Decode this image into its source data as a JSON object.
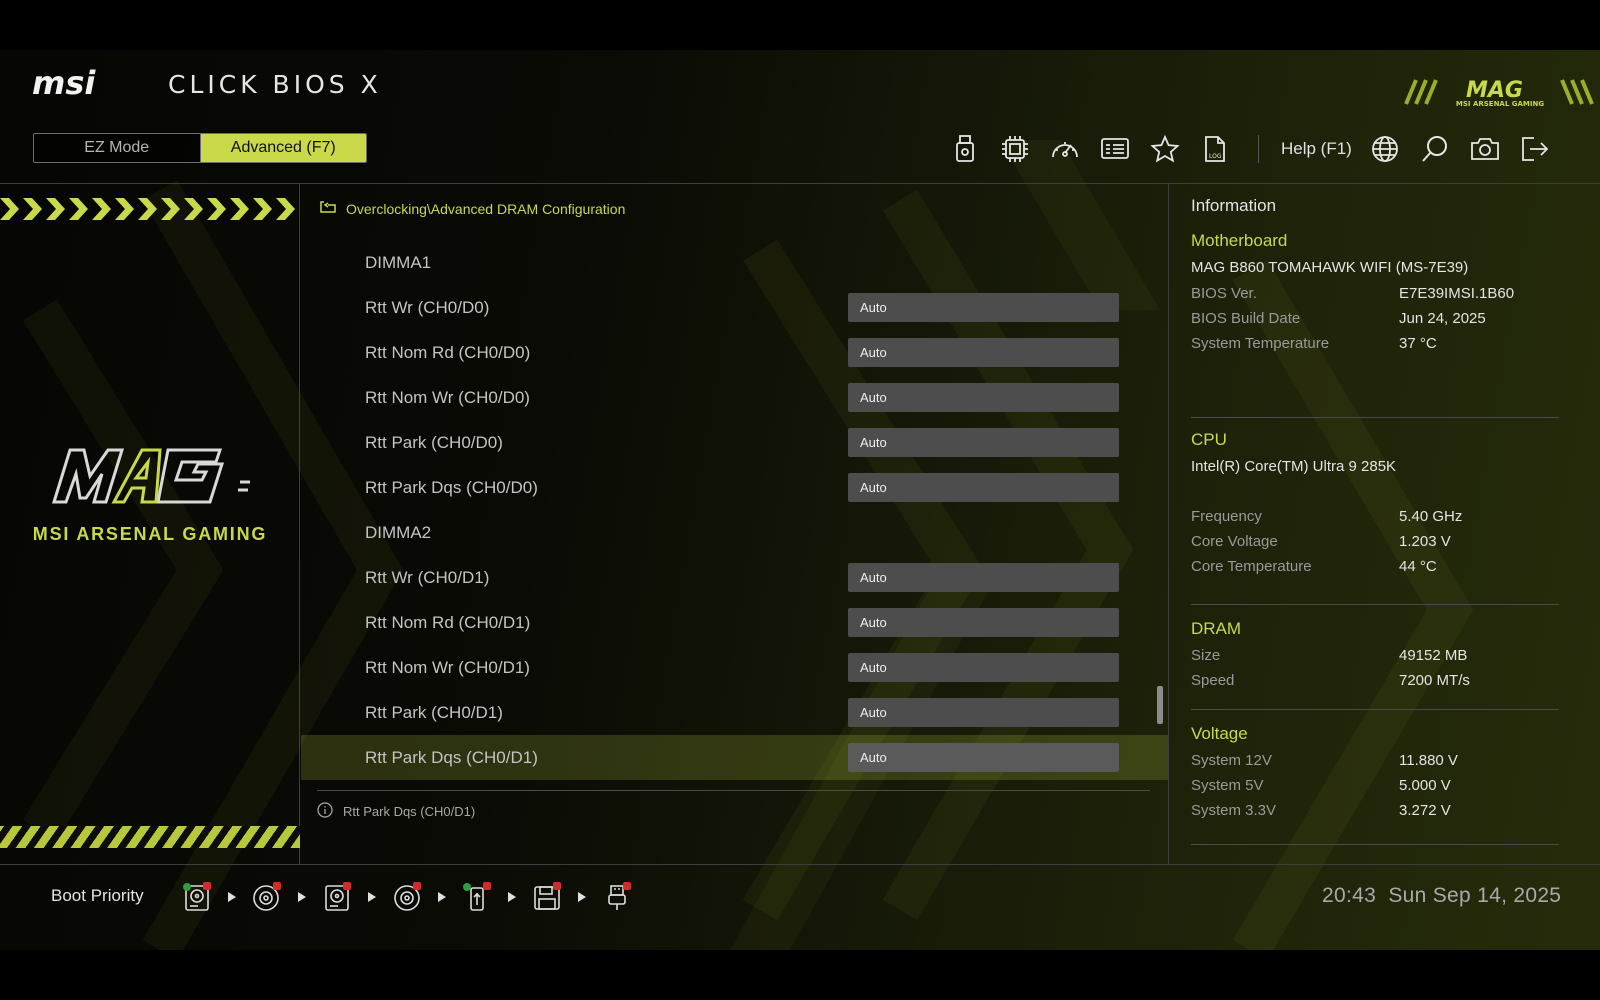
{
  "header": {
    "brand": "msi",
    "product_title": "CLICK BIOS X",
    "mag_logo_text": "MAG",
    "mag_logo_sub": "MSI ARSENAL GAMING",
    "modes": {
      "ez": "EZ Mode",
      "advanced": "Advanced (F7)"
    },
    "toolbar": {
      "icons": [
        "usb-flash-icon",
        "cpu-icon",
        "speedometer-icon",
        "memory-info-icon",
        "favorite-star-icon",
        "log-file-icon",
        "language-globe-icon",
        "search-icon",
        "screenshot-camera-icon",
        "exit-icon"
      ],
      "help_label": "Help (F1)"
    }
  },
  "left_panel": {
    "logo_text": "MAG",
    "logo_caption": "MSI ARSENAL GAMING"
  },
  "breadcrumb": "Overclocking\\Advanced DRAM Configuration",
  "settings": {
    "groups": [
      {
        "label": "DIMMA1",
        "items": [
          {
            "label": "Rtt Wr (CH0/D0)",
            "value": "Auto"
          },
          {
            "label": "Rtt Nom Rd (CH0/D0)",
            "value": "Auto"
          },
          {
            "label": "Rtt Nom Wr (CH0/D0)",
            "value": "Auto"
          },
          {
            "label": "Rtt Park (CH0/D0)",
            "value": "Auto"
          },
          {
            "label": "Rtt Park Dqs (CH0/D0)",
            "value": "Auto"
          }
        ]
      },
      {
        "label": "DIMMA2",
        "items": [
          {
            "label": "Rtt Wr (CH0/D1)",
            "value": "Auto"
          },
          {
            "label": "Rtt Nom Rd (CH0/D1)",
            "value": "Auto"
          },
          {
            "label": "Rtt Nom Wr (CH0/D1)",
            "value": "Auto"
          },
          {
            "label": "Rtt Park (CH0/D1)",
            "value": "Auto"
          },
          {
            "label": "Rtt Park Dqs (CH0/D1)",
            "value": "Auto"
          }
        ]
      }
    ],
    "selected": "Rtt Park Dqs (CH0/D1)",
    "help_text": "Rtt Park Dqs (CH0/D1)"
  },
  "info": {
    "title": "Information",
    "motherboard": {
      "title": "Motherboard",
      "model": "MAG B860 TOMAHAWK WIFI (MS-7E39)",
      "rows": [
        {
          "k": "BIOS Ver.",
          "v": "E7E39IMSI.1B60"
        },
        {
          "k": "BIOS Build Date",
          "v": "Jun 24, 2025"
        },
        {
          "k": "System Temperature",
          "v": "37 °C"
        }
      ]
    },
    "cpu": {
      "title": "CPU",
      "model": "Intel(R) Core(TM) Ultra 9 285K",
      "rows": [
        {
          "k": "Frequency",
          "v": "5.40 GHz"
        },
        {
          "k": "Core Voltage",
          "v": "1.203 V"
        },
        {
          "k": "Core Temperature",
          "v": "44 °C"
        }
      ]
    },
    "dram": {
      "title": "DRAM",
      "rows": [
        {
          "k": "Size",
          "v": "49152 MB"
        },
        {
          "k": "Speed",
          "v": "7200 MT/s"
        }
      ]
    },
    "voltage": {
      "title": "Voltage",
      "rows": [
        {
          "k": "System 12V",
          "v": "11.880 V"
        },
        {
          "k": "System 5V",
          "v": "5.000 V"
        },
        {
          "k": "System 3.3V",
          "v": "3.272 V"
        }
      ]
    }
  },
  "footer": {
    "boot_label": "Boot Priority",
    "boot_devices": [
      "hdd-icon",
      "optical-disc-icon",
      "hdd-icon",
      "optical-disc-usb-icon",
      "usb-drive-icon",
      "floppy-usb-icon",
      "usb-plug-icon"
    ],
    "clock_time": "20:43",
    "clock_date": "Sun Sep 14, 2025"
  },
  "colors": {
    "accent": "#c9d94a",
    "value_box": "#4d4d4d",
    "badge": "#d62a2a"
  }
}
